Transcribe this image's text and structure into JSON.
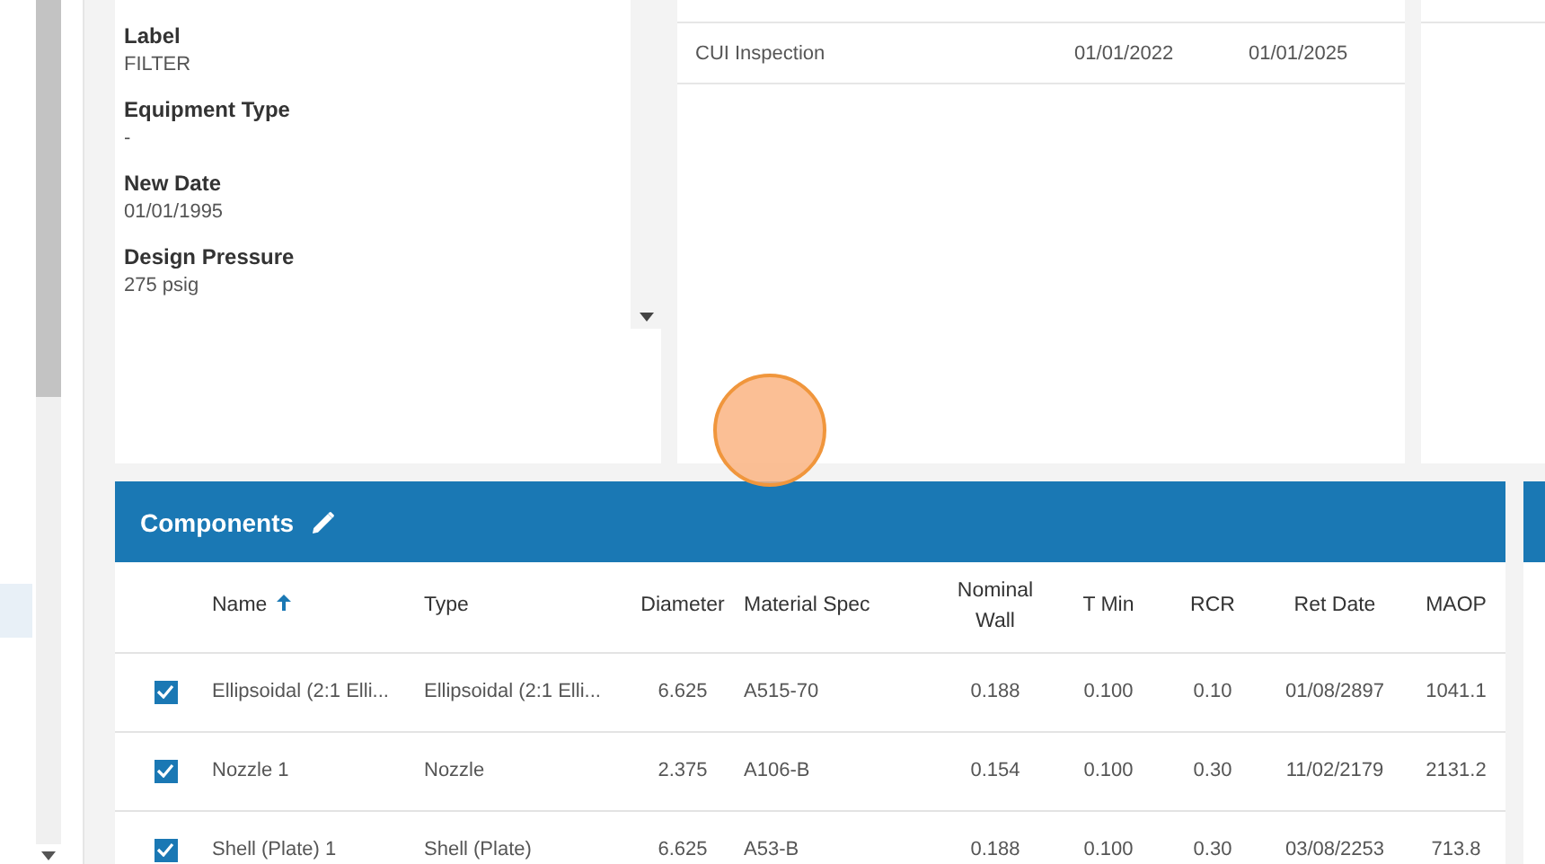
{
  "details": [
    {
      "label": "Label",
      "value": "FILTER"
    },
    {
      "label": "Equipment Type",
      "value": "-"
    },
    {
      "label": "New Date",
      "value": "01/01/1995"
    },
    {
      "label": "Design Pressure",
      "value": "275 psig"
    }
  ],
  "inspections": [
    {
      "name": "CUI Inspection",
      "date_1": "01/01/2022",
      "date_2": "01/01/2025"
    }
  ],
  "components": {
    "title": "Components",
    "columns": [
      {
        "label": "Name",
        "sorted": true
      },
      {
        "label": "Type",
        "sorted": false
      },
      {
        "label": "Diameter",
        "sorted": false
      },
      {
        "label": "Material Spec",
        "sorted": false
      },
      {
        "label": "Nominal Wall",
        "sorted": false
      },
      {
        "label": "T Min",
        "sorted": false
      },
      {
        "label": "RCR",
        "sorted": false
      },
      {
        "label": "Ret Date",
        "sorted": false
      },
      {
        "label": "MAOP",
        "sorted": false
      }
    ],
    "rows": [
      {
        "checked": true,
        "cells": [
          "Ellipsoidal (2:1 Elli...",
          "Ellipsoidal (2:1 Elli...",
          "6.625",
          "A515-70",
          "0.188",
          "0.100",
          "0.10",
          "01/08/2897",
          "1041.1"
        ]
      },
      {
        "checked": true,
        "cells": [
          "Nozzle 1",
          "Nozzle",
          "2.375",
          "A106-B",
          "0.154",
          "0.100",
          "0.30",
          "11/02/2179",
          "2131.2"
        ]
      },
      {
        "checked": true,
        "cells": [
          "Shell (Plate) 1",
          "Shell (Plate)",
          "6.625",
          "A53-B",
          "0.188",
          "0.100",
          "0.30",
          "03/08/2253",
          "713.8"
        ]
      }
    ]
  }
}
